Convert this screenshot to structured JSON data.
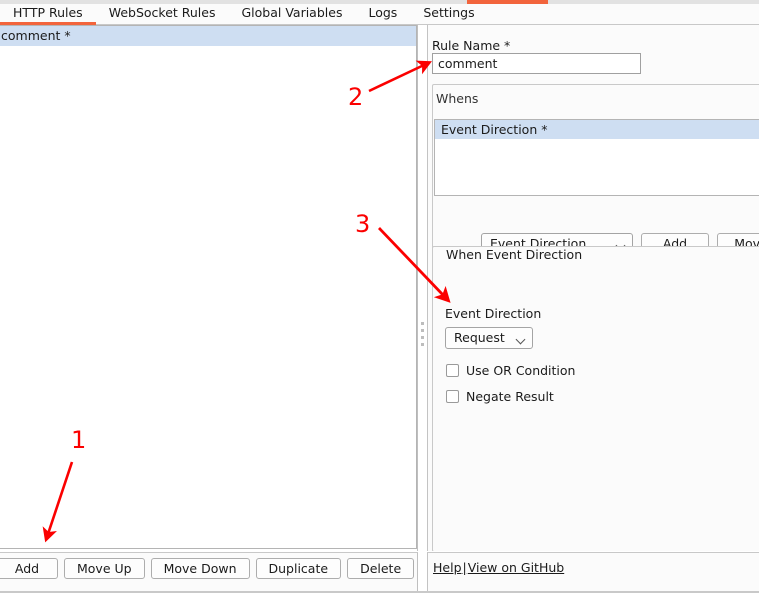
{
  "window": {
    "accent_color": "#f2643c",
    "selection_color": "#cedef2",
    "annotation_color": "#fb0000"
  },
  "tabs": [
    {
      "label": "HTTP Rules",
      "active": true
    },
    {
      "label": "WebSocket Rules",
      "active": false
    },
    {
      "label": "Global Variables",
      "active": false
    },
    {
      "label": "Logs",
      "active": false
    },
    {
      "label": "Settings",
      "active": false
    }
  ],
  "left_panel": {
    "rules": [
      {
        "label": "comment *",
        "selected": true
      }
    ],
    "toolbar": {
      "add_label": "Add",
      "move_up_label": "Move Up",
      "move_down_label": "Move Down",
      "duplicate_label": "Duplicate",
      "delete_label": "Delete"
    }
  },
  "right_panel": {
    "rule_name": {
      "label": "Rule Name *",
      "value": "comment"
    },
    "whens": {
      "title": "Whens",
      "items": [
        {
          "label": "Event Direction *",
          "selected": true
        }
      ],
      "type_combo_value": "Event Direction",
      "add_label": "Add",
      "move_label": "Move"
    },
    "when_detail": {
      "legend": "When Event Direction",
      "event_direction_label": "Event Direction",
      "event_direction_value": "Request",
      "use_or_condition_label": "Use OR Condition",
      "use_or_condition_checked": false,
      "negate_result_label": "Negate Result",
      "negate_result_checked": false
    }
  },
  "footer": {
    "help_label": "Help",
    "separator": "|",
    "github_label": "View on GitHub"
  },
  "annotations": [
    {
      "number": "1"
    },
    {
      "number": "2"
    },
    {
      "number": "3"
    }
  ]
}
